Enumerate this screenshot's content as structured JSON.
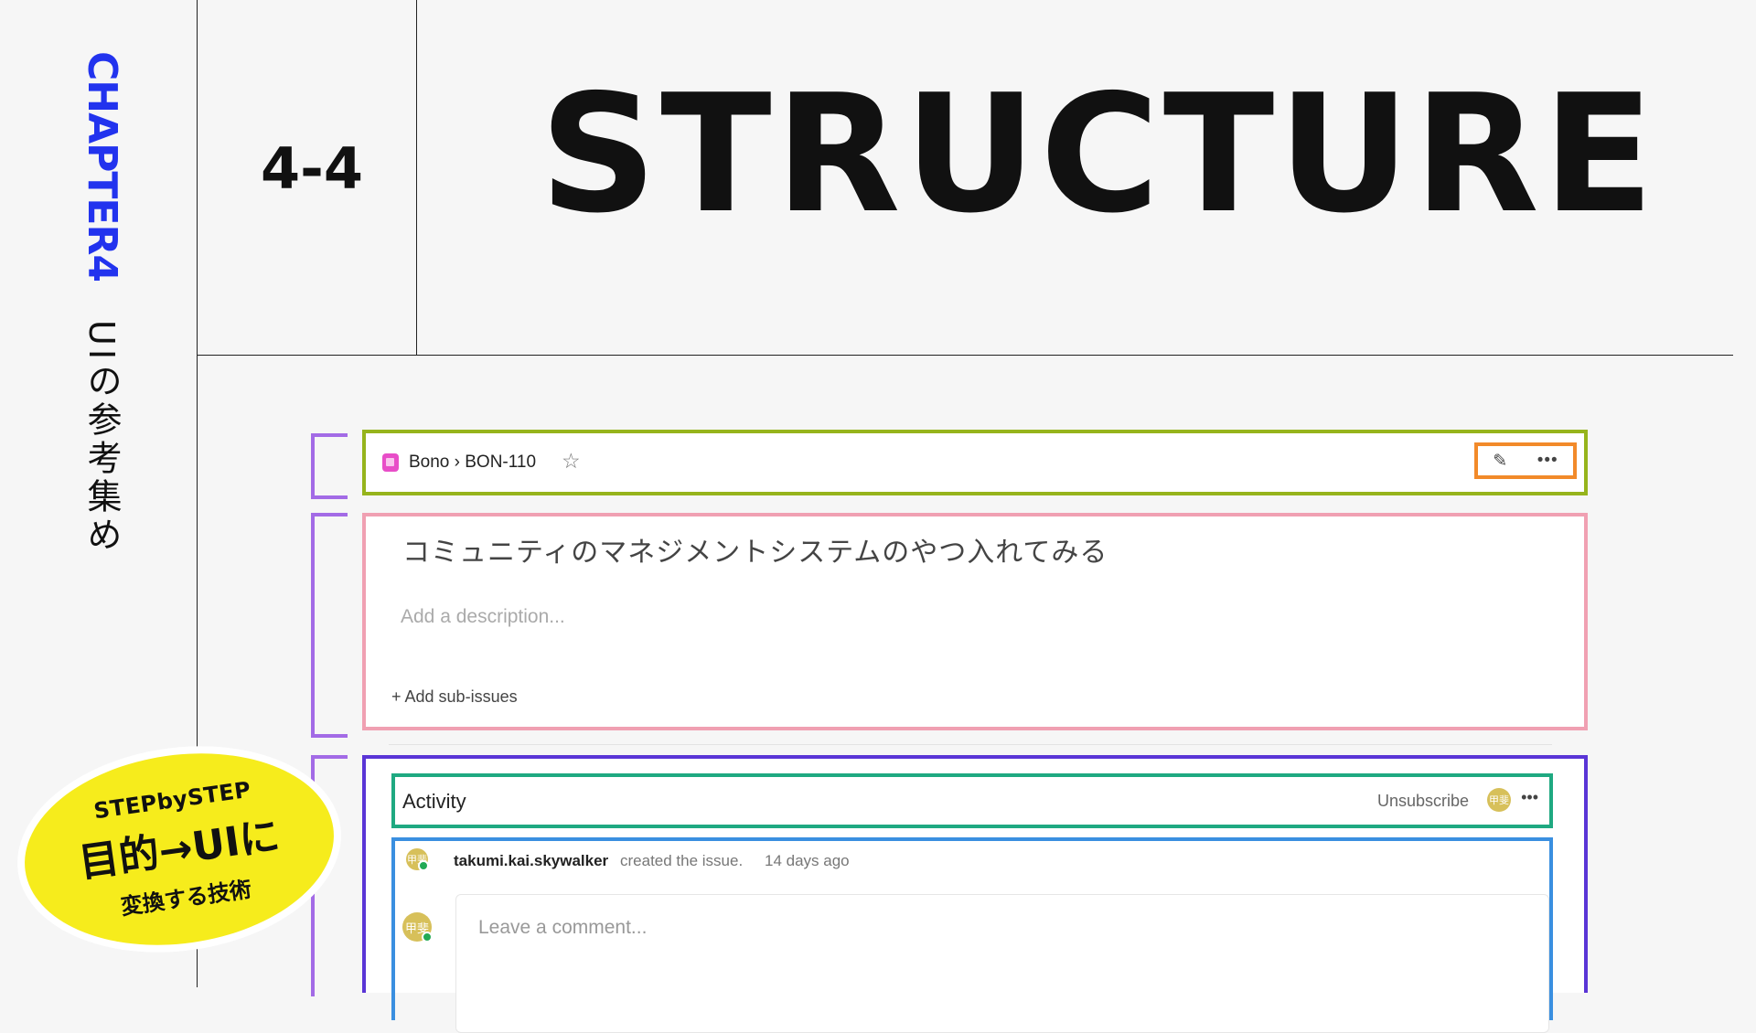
{
  "slide": {
    "chapter": "CHAPTER4",
    "subtitle": "UIの参考集め",
    "section_number": "4-4",
    "title": "STRUCTURE"
  },
  "issue_header": {
    "breadcrumb": "Bono › BON-110",
    "icons": [
      "book-icon",
      "star-icon",
      "pencil-icon",
      "more-icon"
    ]
  },
  "issue": {
    "title": "コミュニティのマネジメントシステムのやつ入れてみる",
    "description_placeholder": "Add a description...",
    "add_sub_issues": "+ Add sub-issues"
  },
  "activity": {
    "title": "Activity",
    "unsubscribe": "Unsubscribe",
    "avatar_text": "甲斐",
    "log_entry": {
      "user": "takumi.kai.skywalker",
      "action": "created the issue.",
      "time": "14 days ago",
      "avatar_text": "甲斐"
    },
    "comment_placeholder": "Leave a comment...",
    "comment_avatar_text": "甲斐"
  },
  "badge": {
    "line1": "STEPbySTEP",
    "line2": "目的→UIに",
    "line3": "変換する技術"
  },
  "colors": {
    "chapter_blue": "#2233ee",
    "bracket_purple": "#a36be6",
    "header_green": "#96b41c",
    "action_orange": "#f28a2a",
    "issue_pink": "#f0a0b2",
    "activity_indigo": "#5a35d6",
    "activity_header_teal": "#1fa981",
    "activity_body_blue": "#3a8fe0",
    "badge_yellow": "#f6ec1c"
  }
}
